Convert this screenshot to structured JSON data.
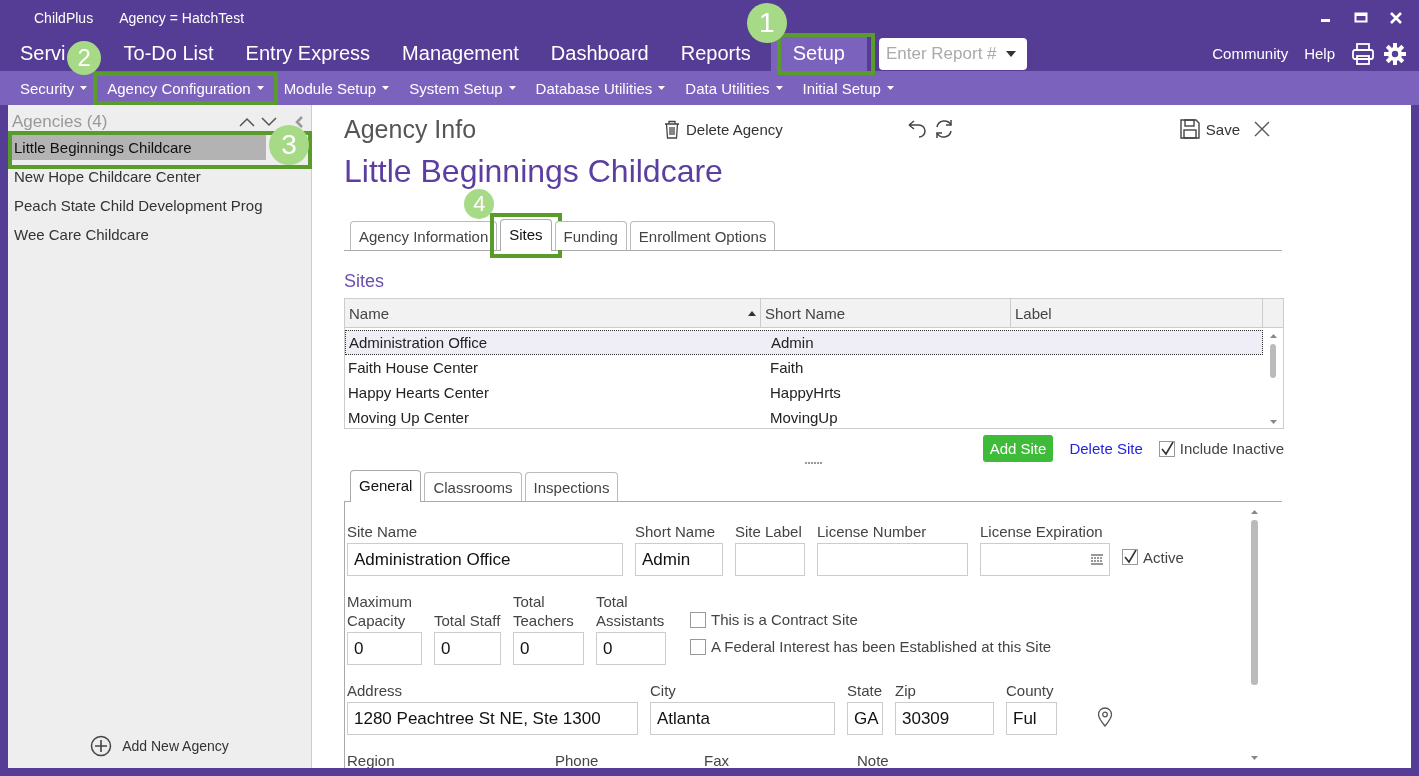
{
  "window": {
    "app": "ChildPlus",
    "context": "Agency = HatchTest"
  },
  "menu": {
    "items": [
      {
        "label": "Servi",
        "selected": false
      },
      {
        "label": "To-Do List",
        "selected": false
      },
      {
        "label": "Entry Express",
        "selected": false
      },
      {
        "label": "Management",
        "selected": false
      },
      {
        "label": "Dashboard",
        "selected": false
      },
      {
        "label": "Reports",
        "selected": false
      },
      {
        "label": "Setup",
        "selected": true,
        "callout": "1"
      }
    ],
    "report_field": {
      "placeholder": "Enter Report #"
    },
    "links": [
      "Community",
      "Help"
    ]
  },
  "submenu": [
    {
      "label": "Security"
    },
    {
      "label": "Agency Configuration",
      "callout": "2"
    },
    {
      "label": "Module Setup"
    },
    {
      "label": "System Setup"
    },
    {
      "label": "Database Utilities"
    },
    {
      "label": "Data Utilities"
    },
    {
      "label": "Initial Setup"
    }
  ],
  "sidebar": {
    "title": "Agencies (4)",
    "items": [
      {
        "label": "Little Beginnings Childcare",
        "selected": true,
        "callout": "3"
      },
      {
        "label": "New Hope Childcare Center",
        "selected": false
      },
      {
        "label": "Peach State Child Development Prog",
        "selected": false
      },
      {
        "label": "Wee Care Childcare",
        "selected": false
      }
    ],
    "add_button": "Add New Agency"
  },
  "main": {
    "title": "Agency Info",
    "delete_button": "Delete Agency",
    "save_button": "Save",
    "agency_name": "Little Beginnings Childcare",
    "tabs": [
      {
        "label": "Agency Information",
        "selected": false
      },
      {
        "label": "Sites",
        "selected": true,
        "callout": "4"
      },
      {
        "label": "Funding",
        "selected": false
      },
      {
        "label": "Enrollment Options",
        "selected": false
      }
    ],
    "sites": {
      "title": "Sites",
      "columns": [
        "Name",
        "Short Name",
        "Label"
      ],
      "rows": [
        {
          "name": "Administration Office",
          "short_name": "Admin",
          "selected": true
        },
        {
          "name": "Faith House Center",
          "short_name": "Faith",
          "selected": false
        },
        {
          "name": "Happy Hearts Center",
          "short_name": "HappyHrts",
          "selected": false
        },
        {
          "name": "Moving Up Center",
          "short_name": "MovingUp",
          "selected": false
        }
      ],
      "add_button": "Add Site",
      "delete_link": "Delete Site",
      "include_inactive": {
        "label": "Include Inactive",
        "checked": true
      }
    },
    "detail_tabs": [
      {
        "label": "General",
        "selected": true
      },
      {
        "label": "Classrooms",
        "selected": false
      },
      {
        "label": "Inspections",
        "selected": false
      }
    ],
    "form": {
      "rows": [
        {
          "fields": [
            {
              "kind": "text",
              "label": "Site Name",
              "value": "Administration Office"
            },
            {
              "kind": "text",
              "label": "Short Name",
              "value": "Admin"
            },
            {
              "kind": "text",
              "label": "Site Label"
            },
            {
              "kind": "text",
              "label": "License Number"
            },
            {
              "kind": "date",
              "label": "License Expiration"
            }
          ],
          "checks": [
            {
              "label": "Active",
              "checked": true
            }
          ]
        },
        {
          "fields": [
            {
              "kind": "text",
              "label": "Maximum Capacity",
              "value": "0"
            },
            {
              "kind": "text",
              "label": "Total Staff",
              "value": "0"
            },
            {
              "kind": "text",
              "label": "Total Teachers",
              "value": "0"
            },
            {
              "kind": "text",
              "label": "Total Assistants",
              "value": "0"
            }
          ],
          "checks": [
            {
              "label": "This is a Contract Site",
              "checked": false
            },
            {
              "label": "A Federal Interest has been Established at this Site",
              "checked": false
            }
          ]
        },
        {
          "fields": [
            {
              "kind": "text",
              "label": "Address",
              "value": "1280 Peachtree St NE, Ste 1300"
            },
            {
              "kind": "text",
              "label": "City",
              "value": "Atlanta"
            },
            {
              "kind": "text",
              "label": "State",
              "value": "GA"
            },
            {
              "kind": "text",
              "label": "Zip",
              "value": "30309"
            },
            {
              "kind": "text",
              "label": "County",
              "value": "Ful"
            }
          ],
          "locate": true
        },
        {
          "fields": [
            {
              "kind": "heading",
              "label": "Region"
            },
            {
              "kind": "heading",
              "label": "Phone"
            },
            {
              "kind": "heading",
              "label": "Fax"
            },
            {
              "kind": "heading",
              "label": "Note"
            }
          ]
        }
      ]
    }
  }
}
